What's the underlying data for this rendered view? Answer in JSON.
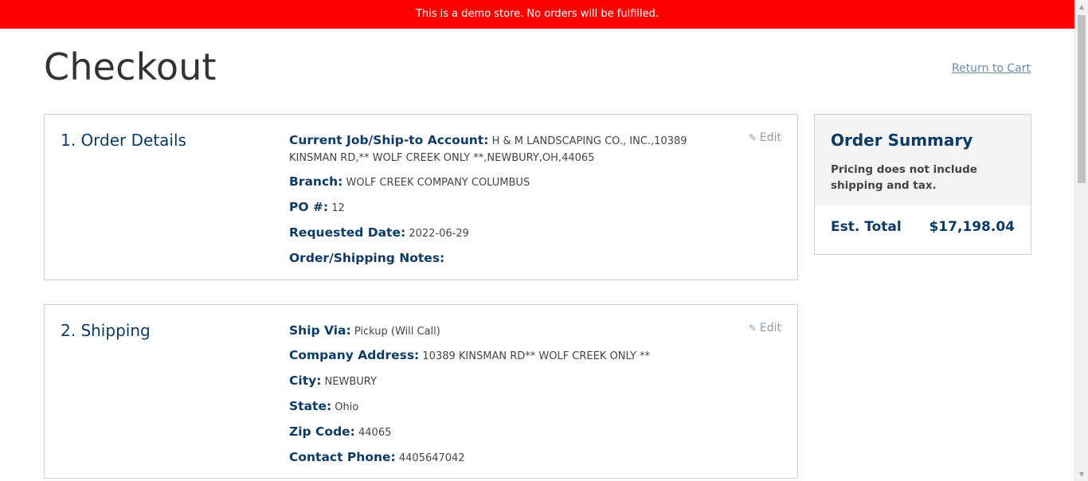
{
  "banner": {
    "text": "This is a demo store. No orders will be fulfilled."
  },
  "page": {
    "title": "Checkout",
    "return_link": "Return to Cart"
  },
  "order_details": {
    "heading": "1. Order Details",
    "edit_label": "Edit",
    "fields": [
      {
        "label": "Current Job/Ship-to Account:",
        "value": "H & M LANDSCAPING CO., INC.,10389 KINSMAN RD,** WOLF CREEK ONLY **,NEWBURY,OH,44065"
      },
      {
        "label": "Branch:",
        "value": "WOLF CREEK COMPANY COLUMBUS"
      },
      {
        "label": "PO #:",
        "value": "12"
      },
      {
        "label": "Requested Date:",
        "value": "2022-06-29"
      },
      {
        "label": "Order/Shipping Notes:",
        "value": ""
      }
    ]
  },
  "shipping": {
    "heading": "2. Shipping",
    "edit_label": "Edit",
    "fields": [
      {
        "label": "Ship Via:",
        "value": "Pickup (Will Call)"
      },
      {
        "label": "Company Address:",
        "value": "10389 KINSMAN RD** WOLF CREEK ONLY **"
      },
      {
        "label": "City:",
        "value": "NEWBURY"
      },
      {
        "label": "State:",
        "value": "Ohio"
      },
      {
        "label": "Zip Code:",
        "value": "44065"
      },
      {
        "label": "Contact Phone:",
        "value": "4405647042"
      }
    ]
  },
  "summary": {
    "title": "Order Summary",
    "note": "Pricing does not include shipping and tax.",
    "total_label": "Est. Total",
    "total_value": "$17,198.04"
  },
  "colors": {
    "banner": "#ff0000",
    "heading": "#0d3b66",
    "link": "#6b8aa6"
  }
}
